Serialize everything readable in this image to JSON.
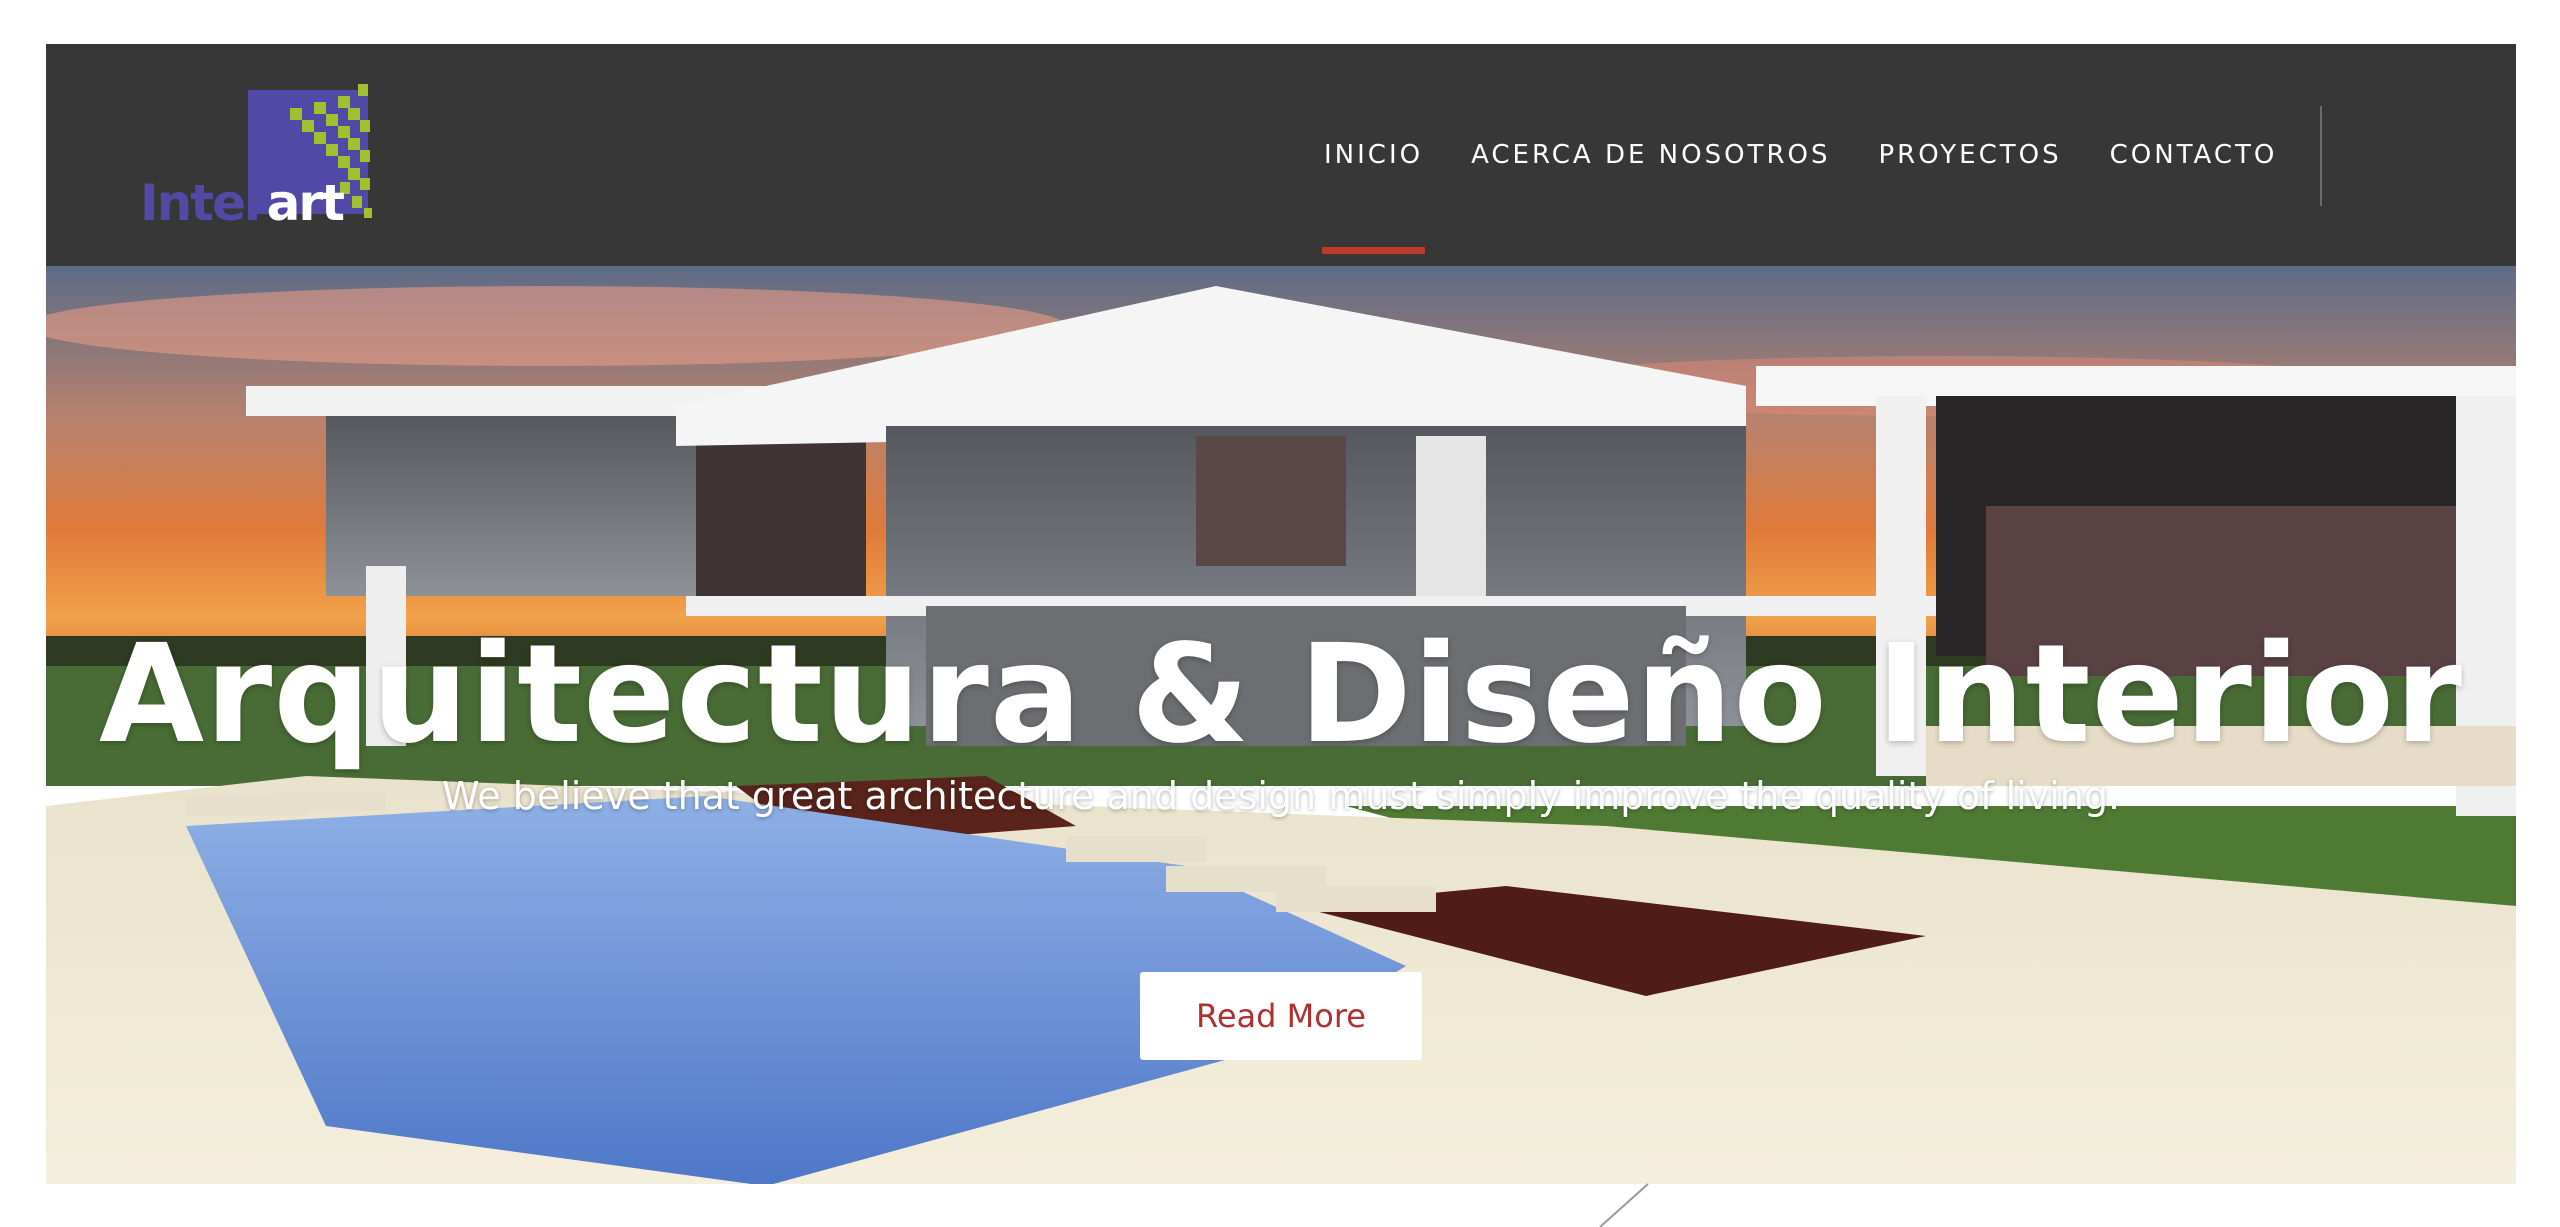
{
  "brand": {
    "logo_part1": "Inter",
    "logo_part2": "art",
    "accent_color": "#c0392b",
    "purple": "#5249a6",
    "green": "#a2bf2f"
  },
  "nav": {
    "items": [
      {
        "label": "INICIO",
        "active": true
      },
      {
        "label": "ACERCA DE NOSOTROS",
        "active": false
      },
      {
        "label": "PROYECTOS",
        "active": false
      },
      {
        "label": "CONTACTO",
        "active": false
      }
    ]
  },
  "hero": {
    "title": "Arquitectura & Diseño Interior",
    "subtitle": "We believe that great architecture and design must simply improve the quality of living.",
    "button_label": "Read More"
  }
}
